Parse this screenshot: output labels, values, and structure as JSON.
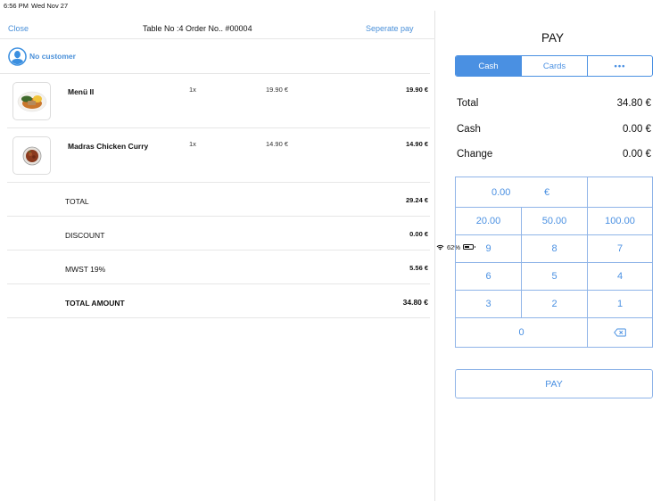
{
  "status_bar": {
    "time": "6:56 PM",
    "date": "Wed Nov 27",
    "battery": "62%",
    "battery_level": 0.62
  },
  "order": {
    "close_label": "Close",
    "title": "Table No :4  Order No.. #00004",
    "separate_pay_label": "Seperate pay",
    "customer_label": "No customer",
    "items": [
      {
        "name": "Menü II",
        "qty": "1x",
        "unit_price": "19.90 €",
        "total": "19.90 €",
        "image": "dish-plate-meat-vegetables"
      },
      {
        "name": "Madras Chicken Curry",
        "qty": "1x",
        "unit_price": "14.90 €",
        "total": "14.90 €",
        "image": "dish-curry-bowl"
      }
    ],
    "summary": [
      {
        "label": "TOTAL",
        "value": "29.24 €"
      },
      {
        "label": "DISCOUNT",
        "value": "0.00 €"
      },
      {
        "label": "MWST 19%",
        "value": "5.56 €"
      },
      {
        "label": "TOTAL AMOUNT",
        "value": "34.80 €"
      }
    ]
  },
  "payment": {
    "title": "PAY",
    "methods": [
      "Cash",
      "Cards",
      "•••"
    ],
    "selected_method": "Cash",
    "totals": [
      {
        "label": "Total",
        "value": "34.80 €"
      },
      {
        "label": "Cash",
        "value": "0.00 €"
      },
      {
        "label": "Change",
        "value": "0.00 €"
      }
    ],
    "input_amount": "0.00",
    "currency": "€",
    "quick_amounts": [
      "20.00",
      "50.00",
      "100.00"
    ],
    "keys": [
      "9",
      "8",
      "7",
      "6",
      "5",
      "4",
      "3",
      "2",
      "1",
      "0"
    ],
    "pay_label": "PAY"
  },
  "colors": {
    "accent": "#4a90e2",
    "link": "#4a90d9",
    "keypad_border": "#8fb4e8",
    "divider": "#e6e6e6"
  }
}
